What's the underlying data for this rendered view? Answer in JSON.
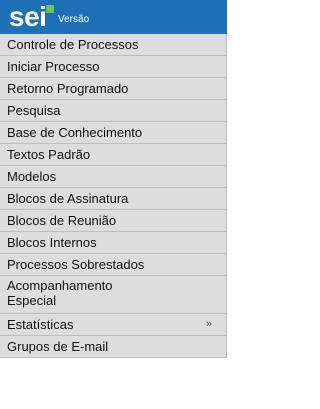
{
  "header": {
    "logo_text": "sei",
    "version_label": "Versão",
    "colors": {
      "header_bg": "#1d6fb8",
      "logo_mark": "#69c552",
      "menu_bg": "#dddddd",
      "menu_text": "#111111"
    }
  },
  "menu": {
    "items": [
      {
        "label": "Controle de Processos"
      },
      {
        "label": "Iniciar Processo"
      },
      {
        "label": "Retorno Programado"
      },
      {
        "label": "Pesquisa"
      },
      {
        "label": "Base de Conhecimento"
      },
      {
        "label": "Textos Padrão"
      },
      {
        "label": "Modelos"
      },
      {
        "label": "Blocos de Assinatura"
      },
      {
        "label": "Blocos de Reunião"
      },
      {
        "label": "Blocos Internos"
      },
      {
        "label": "Processos Sobrestados"
      },
      {
        "label_line1": "Acompanhamento",
        "label_line2": "Especial"
      },
      {
        "label": "Estatísticas",
        "submenu_icon": "»"
      },
      {
        "label": "Grupos de E-mail"
      }
    ]
  }
}
